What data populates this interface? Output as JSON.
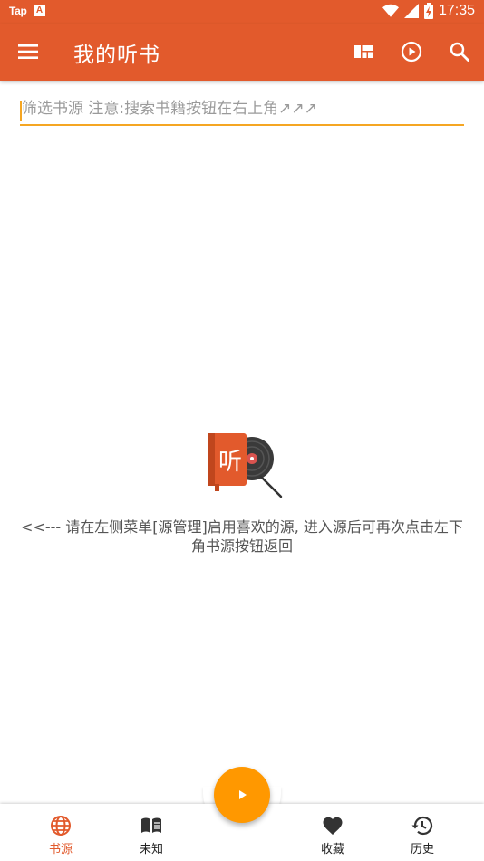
{
  "status_bar": {
    "carrier": "Tap",
    "notif_icon": "A",
    "time": "17:35"
  },
  "app_bar": {
    "title": "我的听书"
  },
  "filter": {
    "placeholder": "筛选书源 注意:搜索书籍按钮在右上角↗↗↗",
    "value": ""
  },
  "empty_state": {
    "message": "<<--- 请在左侧菜单[源管理]启用喜欢的源, 进入源后可再次点击左下角书源按钮返回"
  },
  "bottom_nav": {
    "items": [
      {
        "label": "书源",
        "icon": "globe-icon",
        "active": true
      },
      {
        "label": "未知",
        "icon": "book-icon",
        "active": false
      },
      {
        "label": "收藏",
        "icon": "heart-icon",
        "active": false
      },
      {
        "label": "历史",
        "icon": "history-icon",
        "active": false
      }
    ]
  },
  "colors": {
    "primary": "#e25a2c",
    "accent": "#ff9800",
    "underline": "#f5a623"
  }
}
